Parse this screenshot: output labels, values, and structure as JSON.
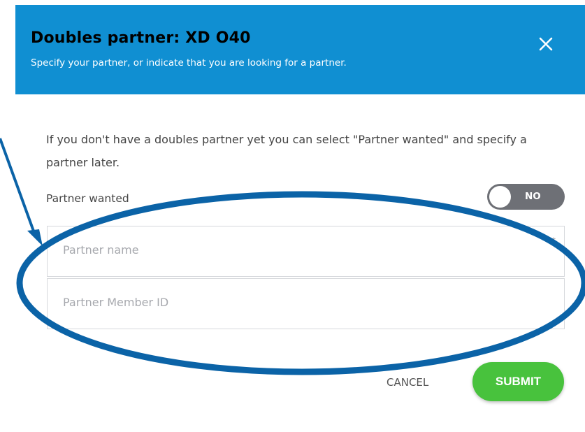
{
  "dialog": {
    "title": "Doubles partner: XD O40",
    "subtitle": "Specify your partner, or indicate that you are looking for a partner.",
    "close_icon": "close-icon"
  },
  "intro_text": "If you don't have a doubles partner yet you can select \"Partner wanted\" and specify a partner later.",
  "partner_wanted": {
    "label": "Partner wanted",
    "toggle_value": "NO",
    "checked": false
  },
  "fields": {
    "partner_name": {
      "placeholder": "Partner name",
      "value": "",
      "required_mark": "*"
    },
    "partner_member_id": {
      "placeholder": "Partner Member ID",
      "value": ""
    }
  },
  "actions": {
    "cancel_label": "CANCEL",
    "submit_label": "SUBMIT"
  },
  "colors": {
    "header": "#108fd2",
    "toggle_off": "#6e7076",
    "submit": "#48c23d",
    "annotation": "#0b63a7"
  }
}
